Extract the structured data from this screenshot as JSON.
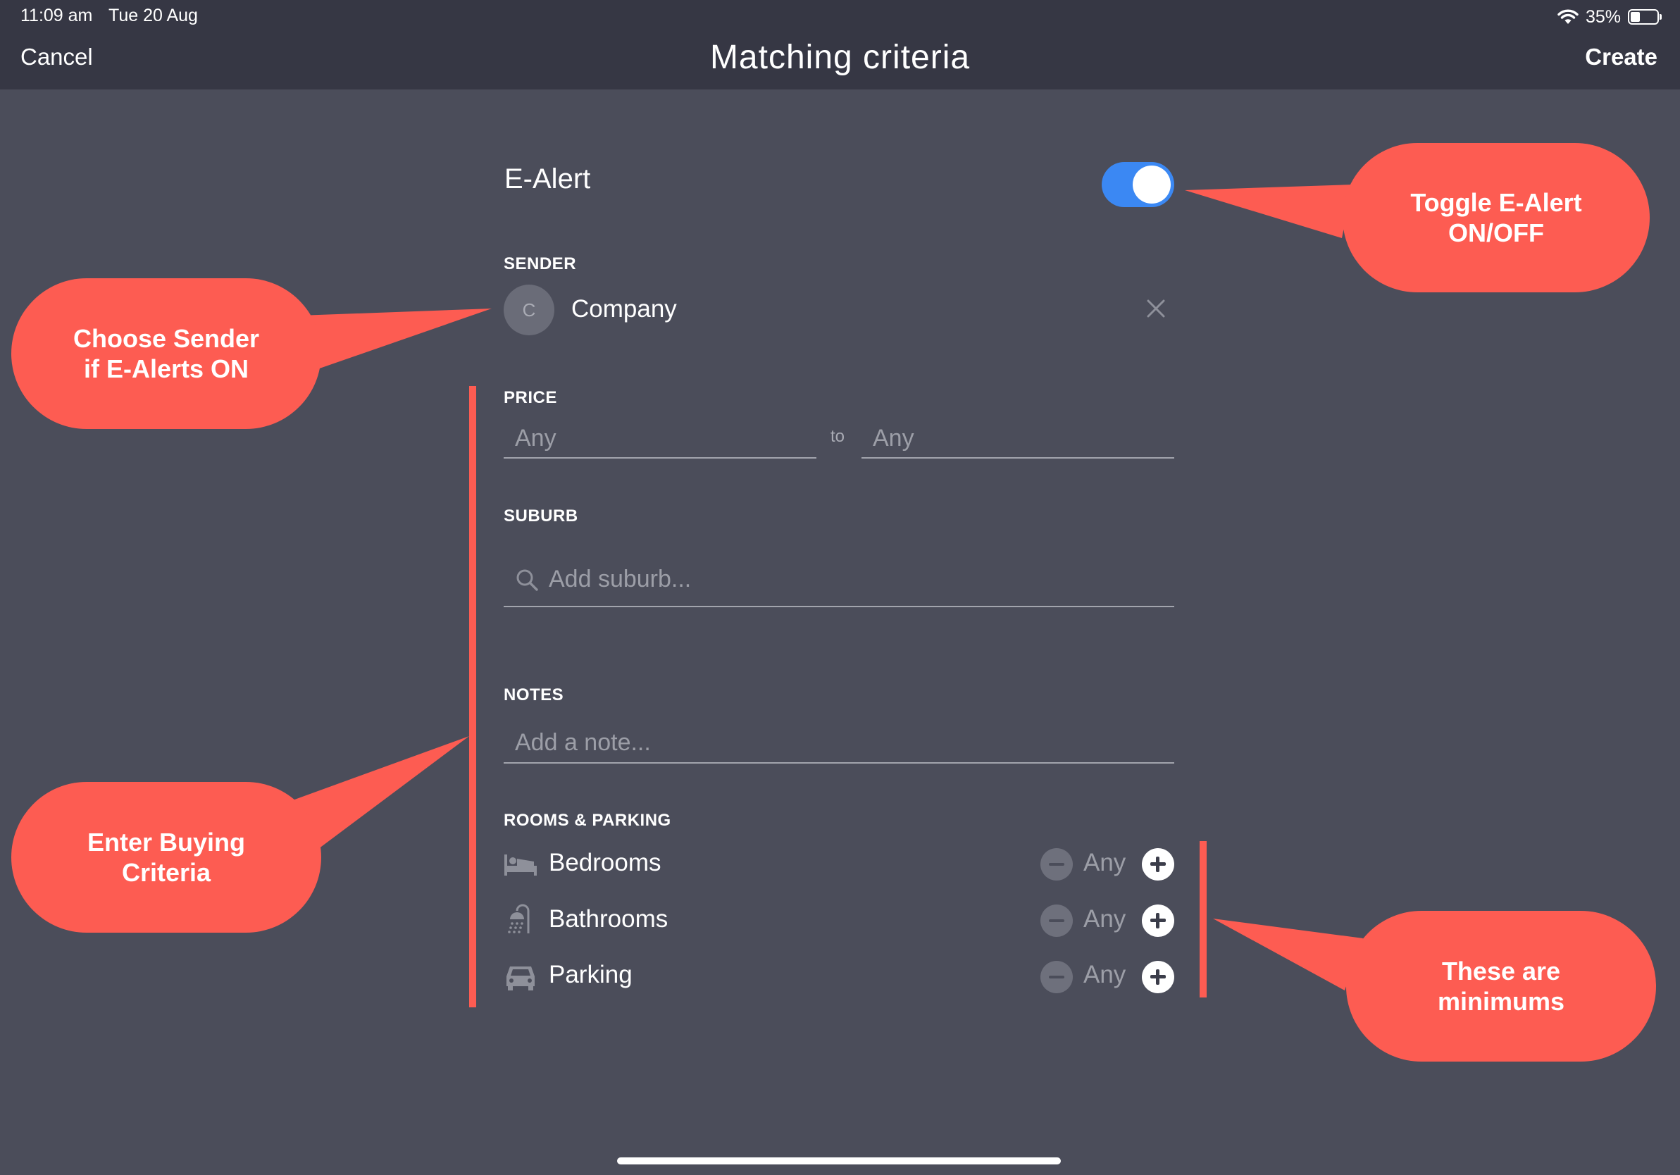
{
  "status_bar": {
    "time": "11:09 am",
    "date": "Tue 20 Aug",
    "battery": "35%",
    "battery_level": 0.35
  },
  "nav": {
    "cancel": "Cancel",
    "title": "Matching criteria",
    "create": "Create"
  },
  "ealert": {
    "label": "E-Alert",
    "enabled": true,
    "accent": "#3b88f3"
  },
  "sender": {
    "section": "SENDER",
    "avatar_initial": "C",
    "name": "Company",
    "clear_icon": "close-icon"
  },
  "price": {
    "section": "PRICE",
    "min_placeholder": "Any",
    "separator": "to",
    "max_placeholder": "Any"
  },
  "suburb": {
    "section": "SUBURB",
    "placeholder": "Add suburb...",
    "icon": "search-icon"
  },
  "notes": {
    "section": "NOTES",
    "placeholder": "Add a note..."
  },
  "rooms": {
    "section": "ROOMS & PARKING",
    "items": [
      {
        "label": "Bedrooms",
        "value": "Any",
        "icon": "bed-icon"
      },
      {
        "label": "Bathrooms",
        "value": "Any",
        "icon": "shower-icon"
      },
      {
        "label": "Parking",
        "value": "Any",
        "icon": "car-icon"
      }
    ]
  },
  "annotations": {
    "color": "#fd5c52",
    "toggle": "Toggle E-Alert\nON/OFF",
    "sender": "Choose Sender\nif E-Alerts ON",
    "criteria": "Enter Buying\nCriteria",
    "minimums": "These are\nminimums"
  }
}
